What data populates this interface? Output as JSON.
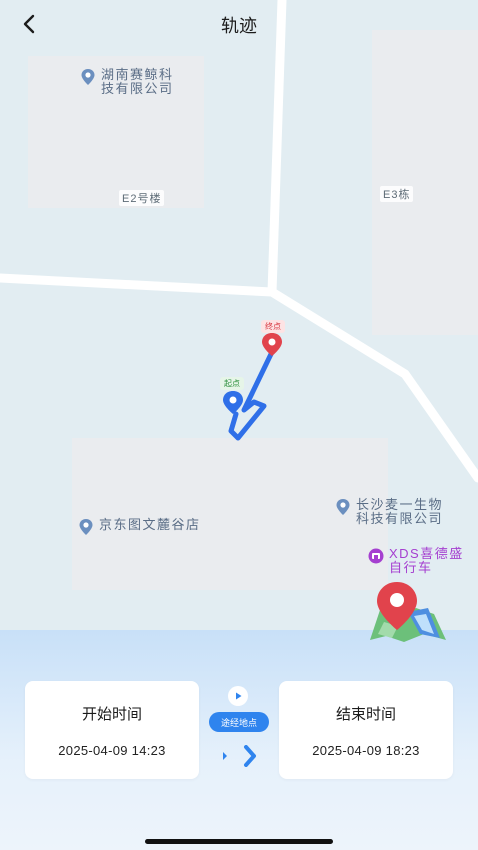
{
  "header": {
    "title": "轨迹",
    "back_icon": "chevron-left-icon"
  },
  "map": {
    "buildings": [
      "E2号楼",
      "E3栋"
    ],
    "pois": [
      {
        "line1": "湖南赛鲸科",
        "line2": "技有限公司",
        "icon": "location-pin-icon"
      },
      {
        "line1": "京东图文麓谷店",
        "icon": "location-pin-icon"
      },
      {
        "line1": "长沙麦一生物",
        "line2": "科技有限公司",
        "icon": "location-pin-icon"
      },
      {
        "line1": "XDS喜德盛",
        "line2": "自行车",
        "icon": "shop-icon"
      }
    ],
    "route": {
      "end_label": "终点",
      "start_label": "起点"
    },
    "route_color": "#2f6fe8"
  },
  "controls": {
    "start": {
      "label": "开始时间",
      "value": "2025-04-09 14:23"
    },
    "end": {
      "label": "结束时间",
      "value": "2025-04-09 18:23"
    },
    "waypoint_label": "途经地点",
    "play_icon": "play-icon",
    "step_icons": [
      "step-small-icon",
      "step-forward-icon"
    ]
  },
  "colors": {
    "accent": "#2f84ee",
    "end_pin": "#e1434c",
    "poi_purple": "#a53fd0"
  }
}
